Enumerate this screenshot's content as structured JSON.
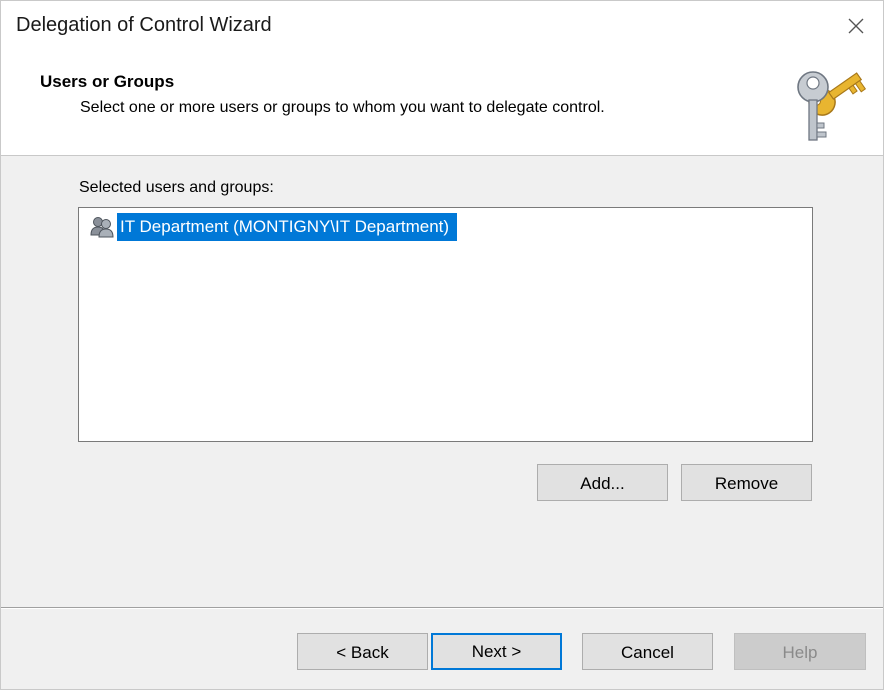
{
  "window": {
    "title": "Delegation of Control Wizard"
  },
  "header": {
    "title": "Users or Groups",
    "subtitle": "Select one or more users or groups to whom you want to delegate control."
  },
  "selection": {
    "label": "Selected users and groups:",
    "items": [
      {
        "label": "IT Department (MONTIGNY\\IT Department)",
        "selected": true,
        "icon": "group-icon"
      }
    ]
  },
  "list_buttons": {
    "add_label": "Add...",
    "remove_label": "Remove"
  },
  "footer": {
    "back_label": "< Back",
    "next_label": "Next >",
    "cancel_label": "Cancel",
    "help_label": "Help",
    "help_enabled": false
  },
  "colors": {
    "selection_bg": "#0078d7",
    "button_bg": "#e1e1e1",
    "dialog_bg": "#f0f0f0"
  }
}
